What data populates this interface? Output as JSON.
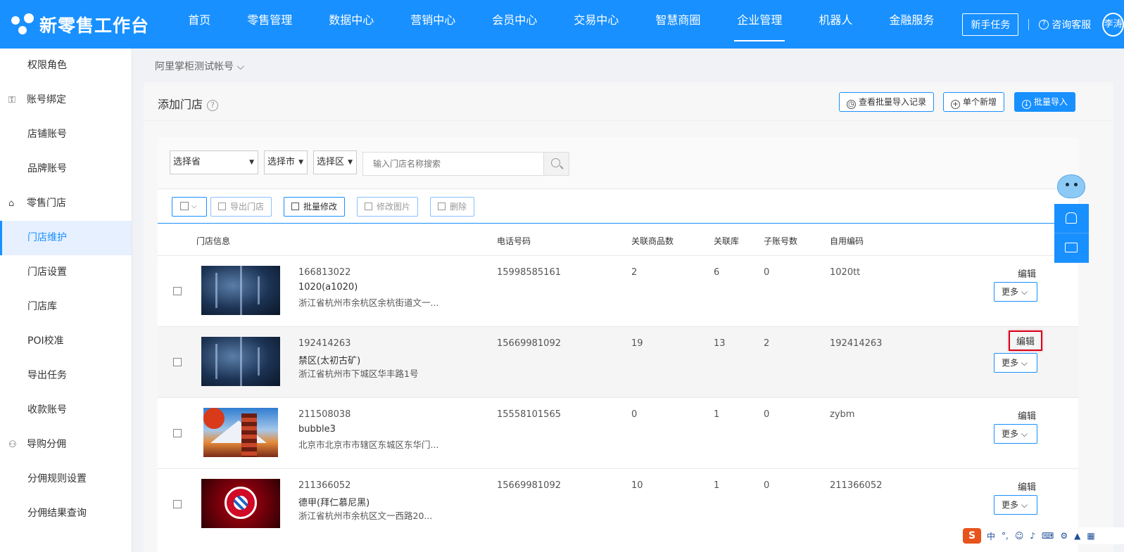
{
  "brand": {
    "name": "新零售工作台"
  },
  "nav": {
    "items": [
      "首页",
      "零售管理",
      "数据中心",
      "营销中心",
      "会员中心",
      "交易中心",
      "智慧商圈",
      "企业管理",
      "机器人",
      "金融服务"
    ],
    "active_index": 7,
    "newbie_button": "新手任务",
    "service": "咨询客服",
    "avatar": "李涛"
  },
  "sidebar": {
    "items": [
      {
        "label": "权限角色",
        "group": false,
        "icon": ""
      },
      {
        "label": "账号绑定",
        "group": true,
        "icon": "account-bind-icon"
      },
      {
        "label": "店铺账号",
        "group": false,
        "icon": ""
      },
      {
        "label": "品牌账号",
        "group": false,
        "icon": ""
      },
      {
        "label": "零售门店",
        "group": true,
        "icon": "store-icon"
      },
      {
        "label": "门店维护",
        "group": false,
        "icon": "",
        "active": true
      },
      {
        "label": "门店设置",
        "group": false,
        "icon": ""
      },
      {
        "label": "门店库",
        "group": false,
        "icon": ""
      },
      {
        "label": "POI校准",
        "group": false,
        "icon": ""
      },
      {
        "label": "导出任务",
        "group": false,
        "icon": ""
      },
      {
        "label": "收款账号",
        "group": false,
        "icon": ""
      },
      {
        "label": "导购分佣",
        "group": true,
        "icon": "users-icon"
      },
      {
        "label": "分佣规则设置",
        "group": false,
        "icon": ""
      },
      {
        "label": "分佣结果查询",
        "group": false,
        "icon": ""
      }
    ]
  },
  "account_selector": "阿里掌柜测试帐号 ⌵",
  "panel": {
    "title": "添加门店",
    "buttons": {
      "history": "查看批量导入记录",
      "single_add": "单个新增",
      "batch_import": "批量导入"
    }
  },
  "filters": {
    "province": "选择省",
    "city": "选择市",
    "district": "选择区",
    "search_placeholder": "输入门店名称搜索"
  },
  "toolbar": {
    "export": "导出门店",
    "batch_edit": "批量修改",
    "edit_image": "修改图片",
    "delete": "删除"
  },
  "table": {
    "headers": {
      "info": "门店信息",
      "phone": "电话号码",
      "goods": "关联商品数",
      "warehouse": "关联库",
      "subaccounts": "子账号数",
      "code": "自用编码"
    },
    "edit_label": "编辑",
    "more_label": "更多 ⌵",
    "rows": [
      {
        "id": "166813022",
        "name": "1020(a1020)",
        "address": "浙江省杭州市余杭区余杭街道文一...",
        "phone": "15998585161",
        "goods": "2",
        "warehouse": "6",
        "subaccounts": "0",
        "code": "1020tt",
        "image": "world-map-image"
      },
      {
        "id": "192414263",
        "name": "禁区(太初古矿)",
        "address": "浙江省杭州市下城区华丰路1号",
        "phone": "15669981092",
        "goods": "19",
        "warehouse": "13",
        "subaccounts": "2",
        "code": "192414263",
        "image": "world-map-image"
      },
      {
        "id": "211508038",
        "name": "bubble3",
        "address": "北京市北京市市辖区东城区东华门...",
        "phone": "15558101565",
        "goods": "0",
        "warehouse": "1",
        "subaccounts": "0",
        "code": "zybm",
        "image": "mount-fuji-image"
      },
      {
        "id": "211366052",
        "name": "德甲(拜仁慕尼黑)",
        "address": "浙江省杭州市余杭区文一西路20...",
        "phone": "15669981092",
        "goods": "10",
        "warehouse": "1",
        "subaccounts": "0",
        "code": "211366052",
        "image": "fc-bayern-image"
      }
    ]
  },
  "ime": {
    "logo": "S",
    "mode": "中"
  },
  "colors": {
    "primary": "#1890ff",
    "highlight_border": "#d9001b"
  }
}
